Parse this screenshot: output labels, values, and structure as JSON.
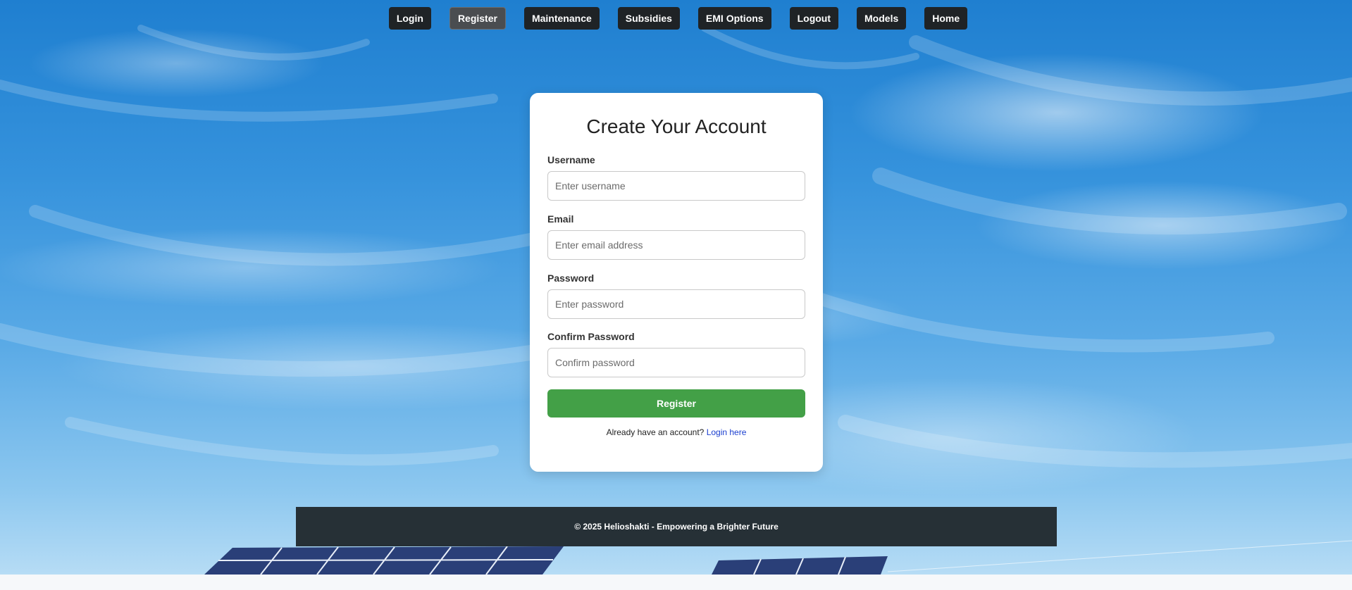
{
  "nav": {
    "items": [
      {
        "label": "Login",
        "active": false
      },
      {
        "label": "Register",
        "active": true
      },
      {
        "label": "Maintenance",
        "active": false
      },
      {
        "label": "Subsidies",
        "active": false
      },
      {
        "label": "EMI Options",
        "active": false
      },
      {
        "label": "Logout",
        "active": false
      },
      {
        "label": "Models",
        "active": false
      },
      {
        "label": "Home",
        "active": false
      }
    ]
  },
  "form": {
    "title": "Create Your Account",
    "fields": [
      {
        "label": "Username",
        "placeholder": "Enter username",
        "value": ""
      },
      {
        "label": "Email",
        "placeholder": "Enter email address",
        "value": ""
      },
      {
        "label": "Password",
        "placeholder": "Enter password",
        "value": ""
      },
      {
        "label": "Confirm Password",
        "placeholder": "Confirm password",
        "value": ""
      }
    ],
    "submit_label": "Register",
    "login_prompt": "Already have an account?",
    "login_link": "Login here"
  },
  "footer": {
    "text": "© 2025 Helioshakti - Empowering a Brighter Future"
  },
  "colors": {
    "nav_bg": "#1f2326",
    "nav_active_bg": "#4a4d50",
    "submit_bg": "#43a047",
    "link": "#1a3ecf",
    "footer_bg": "#263036"
  }
}
